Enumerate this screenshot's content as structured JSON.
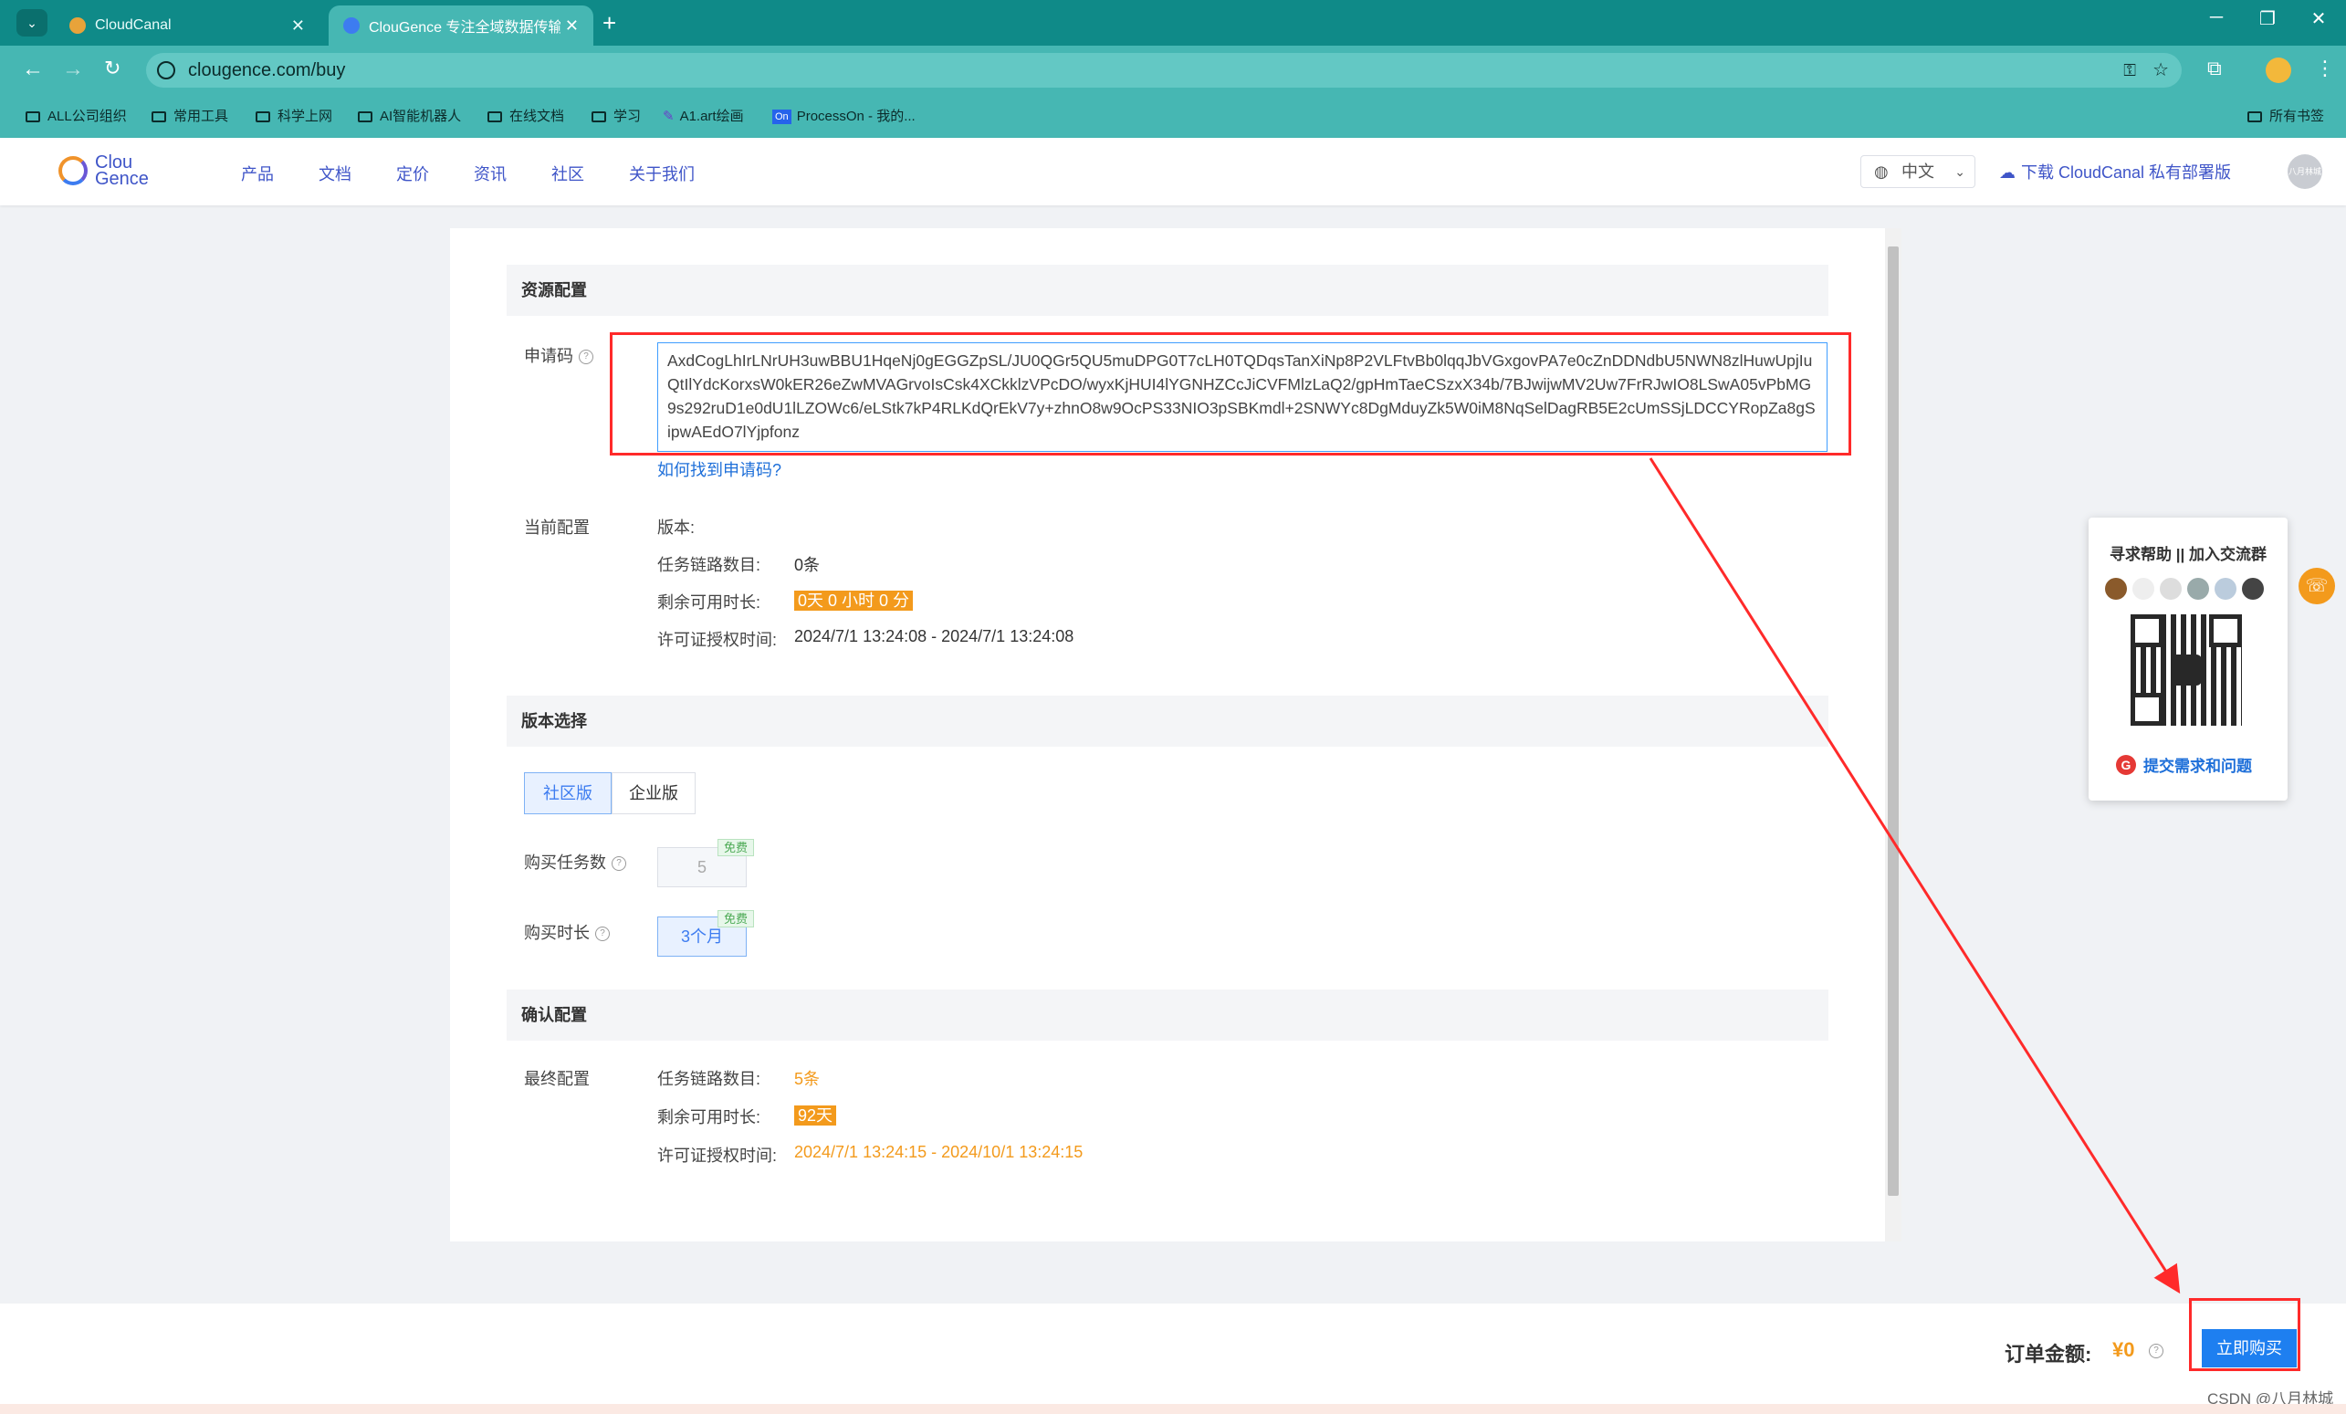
{
  "browser": {
    "tabs": [
      {
        "title": "CloudCanal"
      },
      {
        "title": "ClouGence 专注全域数据传输..."
      }
    ],
    "url": "clougence.com/buy",
    "bookmarks": [
      "ALL公司组织",
      "常用工具",
      "科学上网",
      "AI智能机器人",
      "在线文档",
      "学习",
      "A1.art绘画",
      "ProcessOn - 我的..."
    ],
    "bookmarks_right": "所有书签"
  },
  "site": {
    "logo_top": "Clou",
    "logo_bottom": "Gence",
    "nav": [
      "产品",
      "文档",
      "定价",
      "资讯",
      "社区",
      "关于我们"
    ],
    "language": "中文",
    "download": "下载 CloudCanal 私有部署版",
    "avatar_text": "八月林城"
  },
  "resource": {
    "section_title": "资源配置",
    "apply_code_label": "申请码",
    "apply_code_value": "AxdCogLhIrLNrUH3uwBBU1HqeNj0gEGGZpSL/JU0QGr5QU5muDPG0T7cLH0TQDqsTanXiNp8P2VLFtvBb0lqqJbVGxgovPA7e0cZnDDNdbU5NWN8zlHuwUpjIuQtIlYdcKorxsW0kER26eZwMVAGrvoIsCsk4XCkklzVPcDO/wyxKjHUI4lYGNHZCcJiCVFMlzLaQ2/gpHmTaeCSzxX34b/7BJwijwMV2Uw7FrRJwIO8LSwA05vPbMG9s292ruD1e0dU1lLZOWc6/eLStk7kP4RLKdQrEkV7y+zhnO8w9OcPS33NIO3pSBKmdl+2SNWYc8DgMduyZk5W0iM8NqSelDagRB5E2cUmSSjLDCCYRopZa8gSipwAEdO7lYjpfonz",
    "find_code_link": "如何找到申请码?",
    "current_label": "当前配置",
    "version_key": "版本:",
    "tasks_key": "任务链路数目:",
    "tasks_value": "0条",
    "remain_key": "剩余可用时长:",
    "remain_value": "0天 0 小时 0 分",
    "license_key": "许可证授权时间:",
    "license_value": "2024/7/1 13:24:08 - 2024/7/1 13:24:08"
  },
  "version": {
    "section_title": "版本选择",
    "options": [
      "社区版",
      "企业版"
    ],
    "buy_tasks_label": "购买任务数",
    "buy_tasks_value": "5",
    "buy_duration_label": "购买时长",
    "buy_duration_value": "3个月",
    "free_tag": "免费"
  },
  "confirm": {
    "section_title": "确认配置",
    "final_label": "最终配置",
    "tasks_key": "任务链路数目:",
    "tasks_value": "5条",
    "remain_key": "剩余可用时长:",
    "remain_value": "92天",
    "license_key": "许可证授权时间:",
    "license_value": "2024/7/1 13:24:15 - 2024/10/1 13:24:15"
  },
  "help_widget": {
    "title": "寻求帮助 || 加入交流群",
    "submit": "提交需求和问题"
  },
  "order": {
    "label": "订单金额:",
    "amount": "¥0",
    "buy_button": "立即购买"
  },
  "watermark": "CSDN @八月林城",
  "colors": {
    "accent": "#1e7ff0",
    "highlight": "#f39a1c",
    "annotation": "#ff2a2a",
    "chrome": "#46b7b3"
  }
}
